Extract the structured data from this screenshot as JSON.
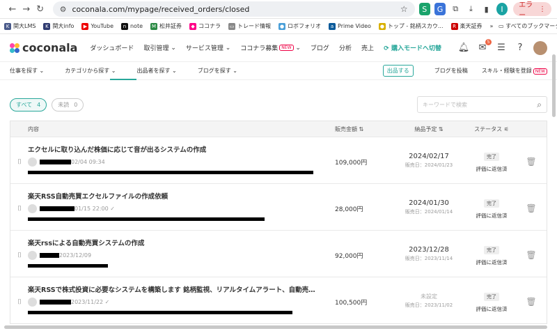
{
  "browser": {
    "url": "coconala.com/mypage/received_orders/closed",
    "error_label": "エラー",
    "profile_initial": "I"
  },
  "bookmarks": [
    {
      "label": "関大LMS",
      "color": "#4a5a8a",
      "icon": "K"
    },
    {
      "label": "関大info",
      "color": "#2f3b70",
      "icon": "K"
    },
    {
      "label": "YouTube",
      "color": "#e00",
      "icon": "▶"
    },
    {
      "label": "note",
      "color": "#111",
      "icon": "n"
    },
    {
      "label": "松井証券",
      "color": "#2a8a44",
      "icon": "M"
    },
    {
      "label": "ココナラ",
      "color": "#f08",
      "icon": "◆"
    },
    {
      "label": "トレード情報",
      "color": "#888",
      "icon": "▭"
    },
    {
      "label": "ロボフォリオ",
      "color": "#4a9fd8",
      "icon": "●"
    },
    {
      "label": "Prime Video",
      "color": "#0a5a9a",
      "icon": "a"
    },
    {
      "label": "トップ - 銘柄スカウ...",
      "color": "#d8b000",
      "icon": "●"
    },
    {
      "label": "楽天証券",
      "color": "#c00",
      "icon": "R"
    }
  ],
  "bookmarks_all": "すべてのブックマーク",
  "header": {
    "logo": "coconala",
    "menu": [
      "ダッシュボード",
      "取引管理",
      "サービス管理",
      "ココナラ募集",
      "ブログ",
      "分析",
      "売上"
    ],
    "new_badge": "NEW",
    "buy_mode": "購入モードへ切替",
    "notif_count": "5"
  },
  "subnav": {
    "items": [
      "仕事を探す",
      "カテゴリから探す",
      "出品者を探す",
      "ブログを探す"
    ],
    "sell": "出品する",
    "post_blog": "ブログを投稿",
    "skill": "スキル・経験を登録",
    "new_badge": "NEW"
  },
  "filters": {
    "all_label": "すべて",
    "all_count": "4",
    "unread_label": "未読",
    "unread_count": "0",
    "search_placeholder": "キーワードで検索"
  },
  "table": {
    "headers": {
      "content": "内容",
      "price": "販売金額",
      "due": "納品予定",
      "status": "ステータス"
    },
    "rows": [
      {
        "title": "エクセルに取り込んだ株価に応じて音が出るシステムの作成",
        "time": "02/04 09:34",
        "price": "109,000円",
        "due": "2024/02/17",
        "sold": "販売日：2024/01/23",
        "status": "完了",
        "reply": "評価に返信済"
      },
      {
        "title": "楽天RSS自動売買エクセルファイルの作成依頼",
        "time": "01/15 22:00 ✓",
        "price": "28,000円",
        "due": "2024/01/30",
        "sold": "販売日：2024/01/14",
        "status": "完了",
        "reply": "評価に返信済"
      },
      {
        "title": "楽天rssによる自動売買システムの作成",
        "time": "2023/12/09",
        "price": "92,000円",
        "due": "2023/12/28",
        "sold": "販売日：2023/11/14",
        "status": "完了",
        "reply": "評価に返信済"
      },
      {
        "title": "楽天RSSで株式投資に必要なシステムを構築します 銘柄監視、リアルタイムアラート、自動売…",
        "time": "2023/11/22 ✓",
        "price": "100,500円",
        "due": "未設定",
        "sold": "販売日：2023/11/02",
        "status": "完了",
        "reply": "評価に返信済"
      }
    ]
  }
}
